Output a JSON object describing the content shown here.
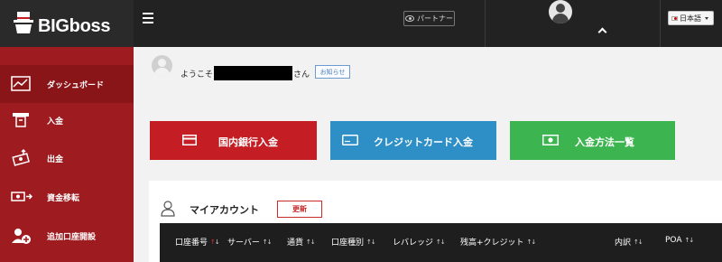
{
  "header": {
    "logo_text": "BIGboss",
    "partner_label": "パートナー",
    "language_label": "日本語"
  },
  "sidebar": {
    "items": [
      {
        "label": "ダッシュボード",
        "icon": "dashboard-chart-icon",
        "active": true
      },
      {
        "label": "入金",
        "icon": "atm-deposit-icon"
      },
      {
        "label": "出金",
        "icon": "cash-withdraw-icon"
      },
      {
        "label": "資金移転",
        "icon": "money-transfer-icon"
      },
      {
        "label": "追加口座開設",
        "icon": "add-account-icon"
      }
    ]
  },
  "welcome": {
    "prefix": "ようこそ",
    "suffix": "さん",
    "notice_label": "お知らせ"
  },
  "deposit_buttons": [
    {
      "label": "国内銀行入金",
      "icon": "bank-card-icon",
      "color": "#c41d23"
    },
    {
      "label": "クレジットカード入金",
      "icon": "credit-card-icon",
      "color": "#2e8fc6"
    },
    {
      "label": "入金方法一覧",
      "icon": "banknote-icon",
      "color": "#3cb44f"
    }
  ],
  "account": {
    "title": "マイアカウント",
    "refresh_label": "更新",
    "columns": [
      "口座番号",
      "サーバー",
      "通貨",
      "口座種別",
      "レバレッジ",
      "残高+クレジット",
      "内訳",
      "POA"
    ]
  },
  "colors": {
    "sidebar_bg": "#9e1b20",
    "header_bg": "#222222",
    "accent_red": "#c92a2a"
  }
}
